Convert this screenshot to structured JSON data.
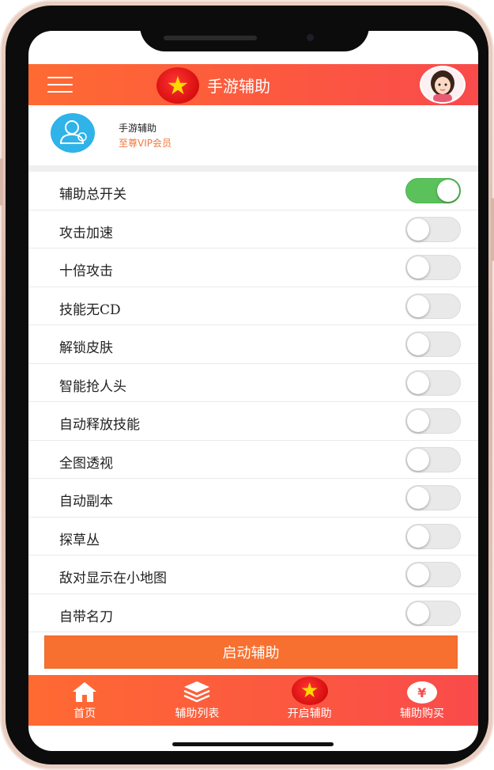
{
  "header": {
    "menu_icon": "hamburger-menu-icon",
    "logo_icon": "star-badge-icon",
    "title": "手游辅助",
    "avatar_icon": "user-avatar-icon"
  },
  "profile": {
    "name": "手游辅助",
    "level": "至尊VIP会员",
    "avatar_icon": "user-profile-icon"
  },
  "features": [
    {
      "label": "辅助总开关",
      "on": true
    },
    {
      "label": "攻击加速",
      "on": false
    },
    {
      "label": "十倍攻击",
      "on": false
    },
    {
      "label": "技能无CD",
      "on": false
    },
    {
      "label": "解锁皮肤",
      "on": false
    },
    {
      "label": "智能抢人头",
      "on": false
    },
    {
      "label": "自动释放技能",
      "on": false
    },
    {
      "label": "全图透视",
      "on": false
    },
    {
      "label": "自动副本",
      "on": false
    },
    {
      "label": "探草丛",
      "on": false
    },
    {
      "label": "敌对显示在小地图",
      "on": false
    },
    {
      "label": "自带名刀",
      "on": false
    }
  ],
  "start_button": "启动辅助",
  "nav": [
    {
      "label": "首页",
      "icon": "home-icon"
    },
    {
      "label": "辅助列表",
      "icon": "layers-icon"
    },
    {
      "label": "开启辅助",
      "icon": "star-badge-icon"
    },
    {
      "label": "辅助购买",
      "icon": "yen-icon"
    }
  ],
  "colors": {
    "accent": "#f77030",
    "header_gradient_start": "#ff6a32",
    "header_gradient_end": "#f94b4b",
    "toggle_on": "#5bc25b",
    "vip_text": "#f0783c"
  }
}
